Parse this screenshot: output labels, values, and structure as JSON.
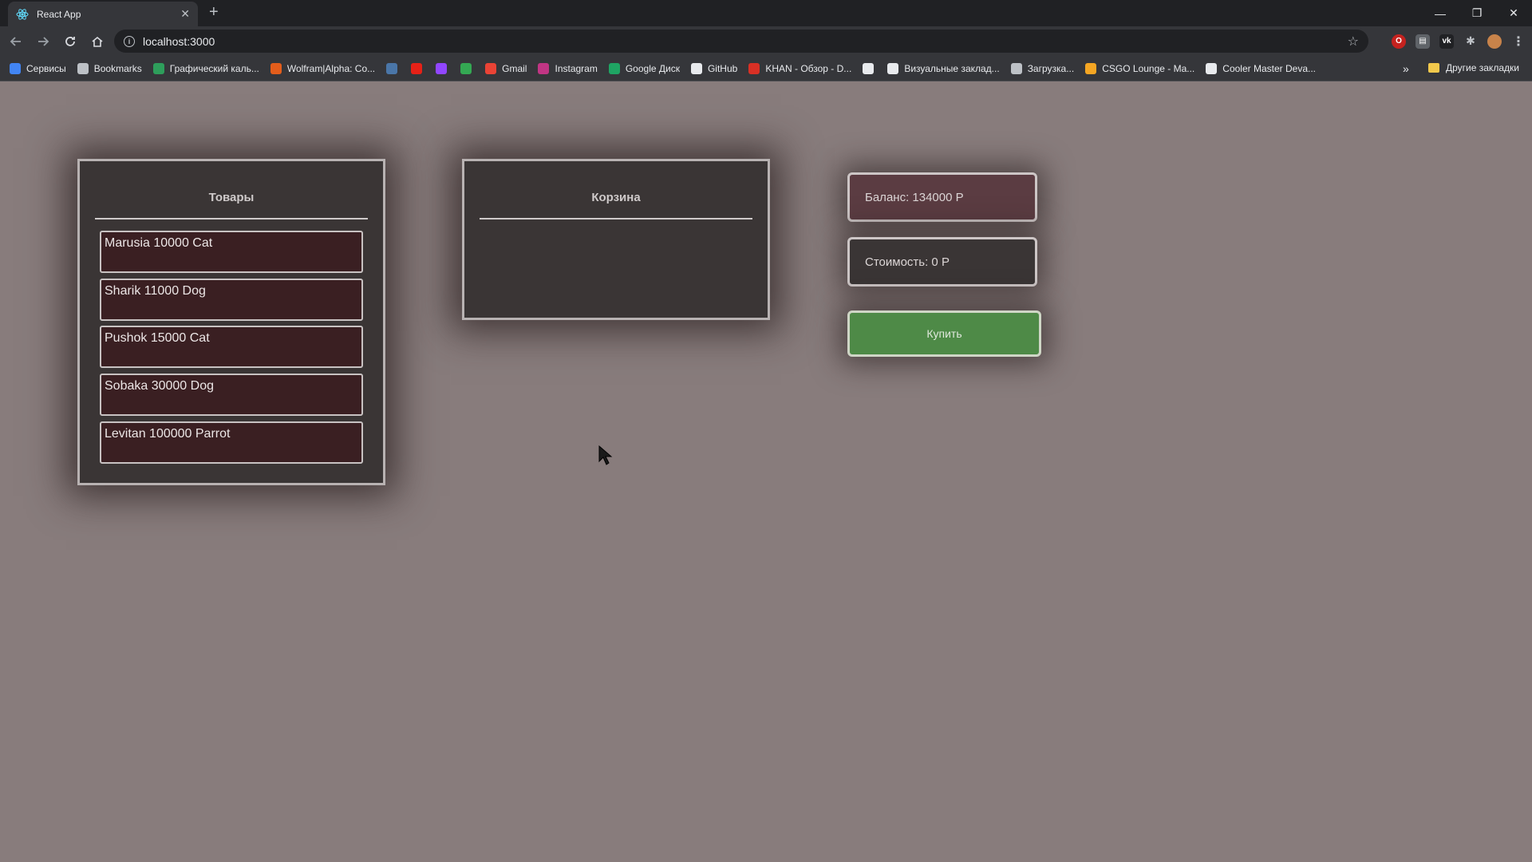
{
  "browser": {
    "tab_title": "React App",
    "url": "localhost:3000",
    "bookmarks": [
      {
        "label": "Сервисы",
        "icon": "apps-grid-icon",
        "color": "#4285f4"
      },
      {
        "label": "Bookmarks",
        "icon": "star-icon",
        "color": "#bdc1c6"
      },
      {
        "label": "Графический каль...",
        "icon": "graph-icon",
        "color": "#2e9e5b"
      },
      {
        "label": "Wolfram|Alpha: Co...",
        "icon": "wolfram-icon",
        "color": "#e35d1b"
      },
      {
        "label": "",
        "icon": "vk-icon",
        "color": "#4a76a8"
      },
      {
        "label": "",
        "icon": "youtube-icon",
        "color": "#e62117"
      },
      {
        "label": "",
        "icon": "twitch-icon",
        "color": "#9146ff"
      },
      {
        "label": "",
        "icon": "colorful-icon",
        "color": "#34a853"
      },
      {
        "label": "Gmail",
        "icon": "gmail-icon",
        "color": "#ea4335"
      },
      {
        "label": "Instagram",
        "icon": "instagram-icon",
        "color": "#c13584"
      },
      {
        "label": "Google Диск",
        "icon": "google-drive-icon",
        "color": "#1fa463"
      },
      {
        "label": "GitHub",
        "icon": "github-icon",
        "color": "#e8eaed"
      },
      {
        "label": "KHAN - Обзор - D...",
        "icon": "khan-icon",
        "color": "#d93025"
      },
      {
        "label": "",
        "icon": "globe-icon",
        "color": "#e8eaed"
      },
      {
        "label": "Визуальные заклад...",
        "icon": "globe-icon",
        "color": "#e8eaed"
      },
      {
        "label": "Загрузка...",
        "icon": "gear-icon",
        "color": "#bdc1c6"
      },
      {
        "label": "CSGO Lounge - Ma...",
        "icon": "csgo-icon",
        "color": "#f5a623"
      },
      {
        "label": "Cooler Master Deva...",
        "icon": "cooler-master-icon",
        "color": "#e8eaed"
      }
    ],
    "more_bookmarks": "»",
    "other_bookmarks": "Другие закладки"
  },
  "app": {
    "goods": {
      "title": "Товары",
      "items": [
        "Marusia 10000 Cat",
        "Sharik 11000 Dog",
        "Pushok 15000 Cat",
        "Sobaka 30000 Dog",
        "Levitan 100000 Parrot"
      ]
    },
    "cart": {
      "title": "Корзина",
      "items": []
    },
    "balance_label": "Баланс: 134000 Р",
    "cost_label": "Стоимость: 0 Р",
    "buy_label": "Купить",
    "colors": {
      "background": "#887c7c",
      "panel": "#3a3535",
      "item": "#3a1f22",
      "balance": "#5b3c42",
      "buy": "#4e8a47"
    }
  }
}
